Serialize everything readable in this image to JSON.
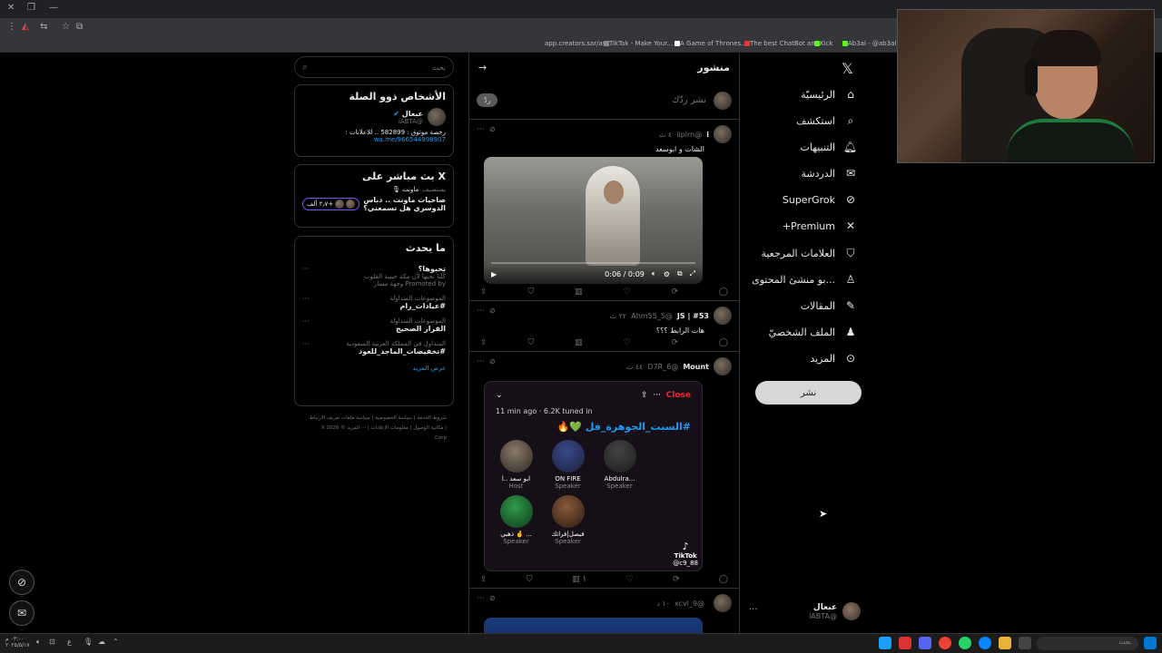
{
  "bookmarks": [
    "app.creators.sar/as...",
    "TikTok - Make Your...",
    "A Game of Thrones...",
    "The best ChatBot an...",
    "Kick",
    "Ab3al - @ab3al |..."
  ],
  "nav": {
    "items": [
      "الرئيسيّة",
      "استكشف",
      "التنبيهات",
      "الدردشة",
      "SuperGrok",
      "Premium+",
      "العلامات المرجعية",
      "...بو منشئ المحتوى",
      "المقالات",
      "الملف الشخصيّ",
      "المزيد"
    ],
    "post_button": "نشر",
    "account_name": "عبعال",
    "account_handle": "@iABTA",
    "more": "···"
  },
  "center": {
    "title": "منشور",
    "reply_placeholder": "نشر ردّك",
    "reply_button": "ردّ",
    "tweets": [
      {
        "name": "i",
        "handle": "@iiplrn",
        "time": "٤ ث",
        "text": "الشات و ابوسعد",
        "video_time": "0:06 / 0:09"
      },
      {
        "name": "#53 | JS",
        "handle": "@Ahm55_5",
        "time": "٢٢ ث",
        "text": "هات الرابط ؟؟؟"
      },
      {
        "name": "Mount",
        "handle": "@D7R_6",
        "time": "٤٤ ث",
        "text": ""
      },
      {
        "name": "",
        "handle": "@xcvl_9",
        "time": "١٠ د",
        "text": ""
      }
    ],
    "action_counts": {
      "views_3": "١"
    },
    "space": {
      "close": "Close",
      "info": "11 min ago · 6.2K tuned in",
      "title": "#السبت_الجوهرة_فل 💚🔥",
      "speakers": [
        {
          "name": "ابو سعد ..ا",
          "role": "Host"
        },
        {
          "name": "ON FIRE",
          "role": "Speaker"
        },
        {
          "name": "Abdulra...",
          "role": "Speaker"
        },
        {
          "name": "ذهبي 🤞 ...",
          "role": "Speaker"
        },
        {
          "name": "فيصل|فراتك",
          "role": "Speaker"
        }
      ],
      "tiktok": "TikTok",
      "tiktok_handle": "@c9_88"
    }
  },
  "right": {
    "search_placeholder": "بحث",
    "relevant": {
      "title": "الأشخاص ذوو الصلة",
      "name": "عبعال",
      "handle": "@iABTA",
      "bio": "رخصة موثوق : 582899 .. للاعلانات :",
      "link": "wa.me/966544998907"
    },
    "live": {
      "title": "X بث مباشر على",
      "host": "ماونت 🎙",
      "host_label": "يستضيف",
      "text": "صاحيات ماونت .. دباس الدوسري هل تسمعني؟",
      "listeners": "+٢٫٧ ألف"
    },
    "happening": {
      "title": "ما يحدث",
      "trends": [
        {
          "category": "",
          "title": "تحبوها؟",
          "sub": "كُلنا نحبها لأن مكة حبيبة القلوب",
          "meta": "Promoted by وجهة مسار"
        },
        {
          "category": "الموضوعات المتداولة",
          "title": "#عيادات_رام"
        },
        {
          "category": "الموضوعات المتداولة",
          "title": "القرار الصحيح"
        },
        {
          "category": "المتداول في المملكة العربية السعودية",
          "title": "#تخفيضات_الماجد_للعود"
        }
      ],
      "show_more": "عرض المزيد"
    },
    "footer": "شروط الخدمة | سياسة الخصوصية | سياسة ملفات تعريف الارتباط | مكانية الوصول | معلومات الإعلانات | ··· المزيد © 2026 X Corp."
  },
  "taskbar": {
    "clock": "٠٣:٠٠ م",
    "date": "٢٠٢٥/٥/١٧",
    "search": "بحث",
    "lang": "ع"
  }
}
